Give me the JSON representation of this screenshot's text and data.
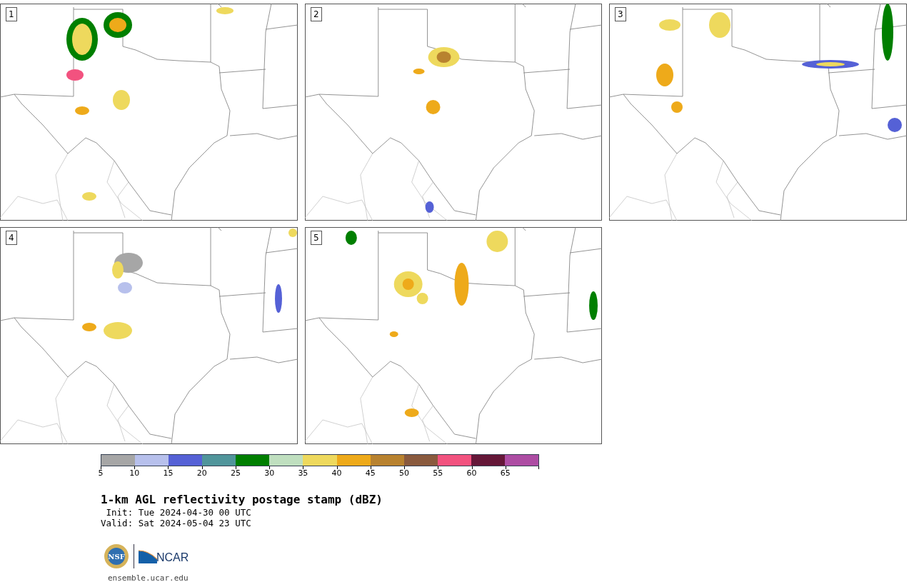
{
  "panels": [
    {
      "number": "1"
    },
    {
      "number": "2"
    },
    {
      "number": "3"
    },
    {
      "number": "4"
    },
    {
      "number": "5"
    }
  ],
  "colorbar": {
    "bins": [
      {
        "color": "#a6a6a6"
      },
      {
        "color": "#b7c0ec"
      },
      {
        "color": "#5561d6"
      },
      {
        "color": "#50959b"
      },
      {
        "color": "#007f00"
      },
      {
        "color": "#bfdfbf"
      },
      {
        "color": "#eed95d"
      },
      {
        "color": "#eeaa1a"
      },
      {
        "color": "#b8822f"
      },
      {
        "color": "#8a5a3e"
      },
      {
        "color": "#f2527f"
      },
      {
        "color": "#651738"
      },
      {
        "color": "#ad4ca3"
      }
    ],
    "ticks": [
      "5",
      "10",
      "15",
      "20",
      "25",
      "30",
      "35",
      "40",
      "45",
      "50",
      "55",
      "60",
      "65"
    ]
  },
  "title": "1-km AGL reflectivity postage stamp (dBZ)",
  "init": " Init: Tue 2024-04-30 00 UTC",
  "valid": "Valid: Sat 2024-05-04 23 UTC",
  "logos": {
    "seal_text": "NSF",
    "wordmark": "NCAR"
  },
  "footer_url": "ensemble.ucar.edu"
}
